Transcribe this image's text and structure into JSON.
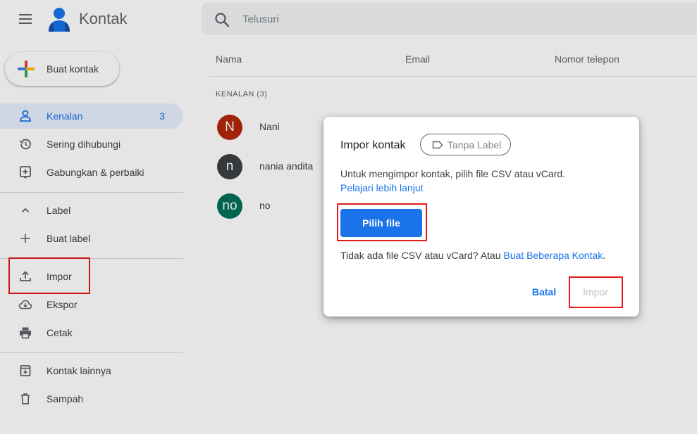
{
  "app": {
    "title": "Kontak"
  },
  "search": {
    "placeholder": "Telusuri"
  },
  "sidebar": {
    "create_label": "Buat kontak",
    "items": [
      {
        "label": "Kenalan",
        "count": "3"
      },
      {
        "label": "Sering dihubungi"
      },
      {
        "label": "Gabungkan & perbaiki"
      },
      {
        "label": "Label"
      },
      {
        "label": "Buat label"
      },
      {
        "label": "Impor"
      },
      {
        "label": "Ekspor"
      },
      {
        "label": "Cetak"
      },
      {
        "label": "Kontak lainnya"
      },
      {
        "label": "Sampah"
      }
    ]
  },
  "table": {
    "headers": [
      "Nama",
      "Email",
      "Nomor telepon"
    ],
    "group_label": "KENALAN (3)",
    "contacts": [
      {
        "initial": "N",
        "name": "Nani",
        "color": "#b3260b"
      },
      {
        "initial": "n",
        "name": "nania andita",
        "color": "#3c4043"
      },
      {
        "initial": "no",
        "name": "no",
        "color": "#00705a"
      }
    ]
  },
  "dialog": {
    "title": "Impor kontak",
    "chip_label": "Tanpa Label",
    "text": "Untuk mengimpor kontak, pilih file CSV atau vCard.",
    "learn_more": "Pelajari lebih lanjut",
    "choose_file": "Pilih file",
    "text2": "Tidak ada file CSV atau vCard? Atau ",
    "text2_link": "Buat Beberapa Kontak",
    "text2_end": ".",
    "cancel": "Batal",
    "import": "Impor"
  },
  "colors": {
    "accent": "#1a73e8",
    "highlight": "#e01b1b"
  }
}
